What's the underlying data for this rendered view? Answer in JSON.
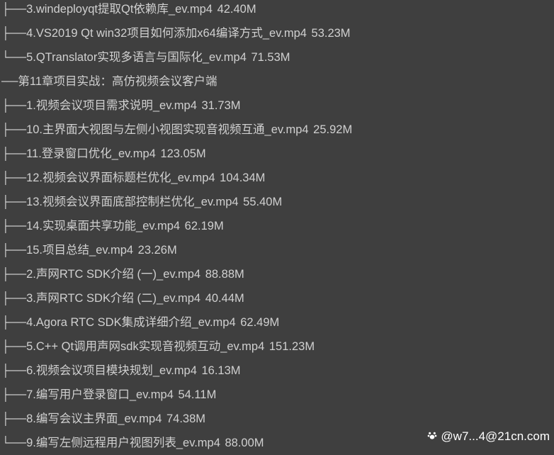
{
  "rows": [
    {
      "type": "file",
      "prefix": "├──",
      "name": "3.windeployqt提取Qt依赖库_ev.mp4",
      "size": "42.40M"
    },
    {
      "type": "file",
      "prefix": "├──",
      "name": "4.VS2019 Qt win32项目如何添加x64编译方式_ev.mp4",
      "size": "53.23M"
    },
    {
      "type": "file",
      "prefix": "└──",
      "name": "5.QTranslator实现多语言与国际化_ev.mp4",
      "size": "71.53M"
    },
    {
      "type": "chapter",
      "prefix": "──",
      "name": "第11章项目实战：高仿视频会议客户端",
      "size": ""
    },
    {
      "type": "file",
      "prefix": "├──",
      "name": "1.视频会议项目需求说明_ev.mp4",
      "size": "31.73M"
    },
    {
      "type": "file",
      "prefix": "├──",
      "name": "10.主界面大视图与左侧小视图实现音视频互通_ev.mp4",
      "size": "25.92M"
    },
    {
      "type": "file",
      "prefix": "├──",
      "name": "11.登录窗口优化_ev.mp4",
      "size": "123.05M"
    },
    {
      "type": "file",
      "prefix": "├──",
      "name": "12.视频会议界面标题栏优化_ev.mp4",
      "size": "104.34M"
    },
    {
      "type": "file",
      "prefix": "├──",
      "name": "13.视频会议界面底部控制栏优化_ev.mp4",
      "size": "55.40M"
    },
    {
      "type": "file",
      "prefix": "├──",
      "name": "14.实现桌面共享功能_ev.mp4",
      "size": "62.19M"
    },
    {
      "type": "file",
      "prefix": "├──",
      "name": "15.项目总结_ev.mp4",
      "size": "23.26M"
    },
    {
      "type": "file",
      "prefix": "├──",
      "name": "2.声网RTC SDK介绍 (一)_ev.mp4",
      "size": "88.88M"
    },
    {
      "type": "file",
      "prefix": "├──",
      "name": "3.声网RTC SDK介绍 (二)_ev.mp4",
      "size": "40.44M"
    },
    {
      "type": "file",
      "prefix": "├──",
      "name": "4.Agora RTC SDK集成详细介绍_ev.mp4",
      "size": "62.49M"
    },
    {
      "type": "file",
      "prefix": "├──",
      "name": "5.C++ Qt调用声网sdk实现音视频互动_ev.mp4",
      "size": "151.23M"
    },
    {
      "type": "file",
      "prefix": "├──",
      "name": "6.视频会议项目模块规划_ev.mp4",
      "size": "16.13M"
    },
    {
      "type": "file",
      "prefix": "├──",
      "name": "7.编写用户登录窗口_ev.mp4",
      "size": "54.11M"
    },
    {
      "type": "file",
      "prefix": "├──",
      "name": "8.编写会议主界面_ev.mp4",
      "size": "74.38M"
    },
    {
      "type": "file",
      "prefix": "└──",
      "name": "9.编写左侧远程用户视图列表_ev.mp4",
      "size": "88.00M"
    }
  ],
  "watermark": {
    "icon": "paw-icon",
    "text": "@w7...4@21cn.com"
  }
}
